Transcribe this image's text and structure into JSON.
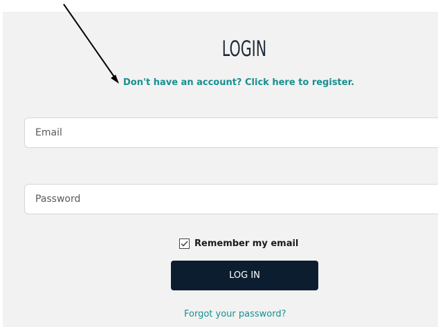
{
  "login": {
    "title": "LOGIN",
    "register_link": "Don't have an account? Click here to register.",
    "email_placeholder": "Email",
    "password_placeholder": "Password",
    "remember_label": "Remember my email",
    "remember_checked": true,
    "submit_label": "LOG IN",
    "forgot_link": "Forgot your password?"
  },
  "annotation": {
    "arrow_icon": "arrow-pointer-icon"
  },
  "colors": {
    "background": "#f2f2f2",
    "link": "#178f8f",
    "button": "#0c1d30",
    "title": "#1f2a38"
  }
}
